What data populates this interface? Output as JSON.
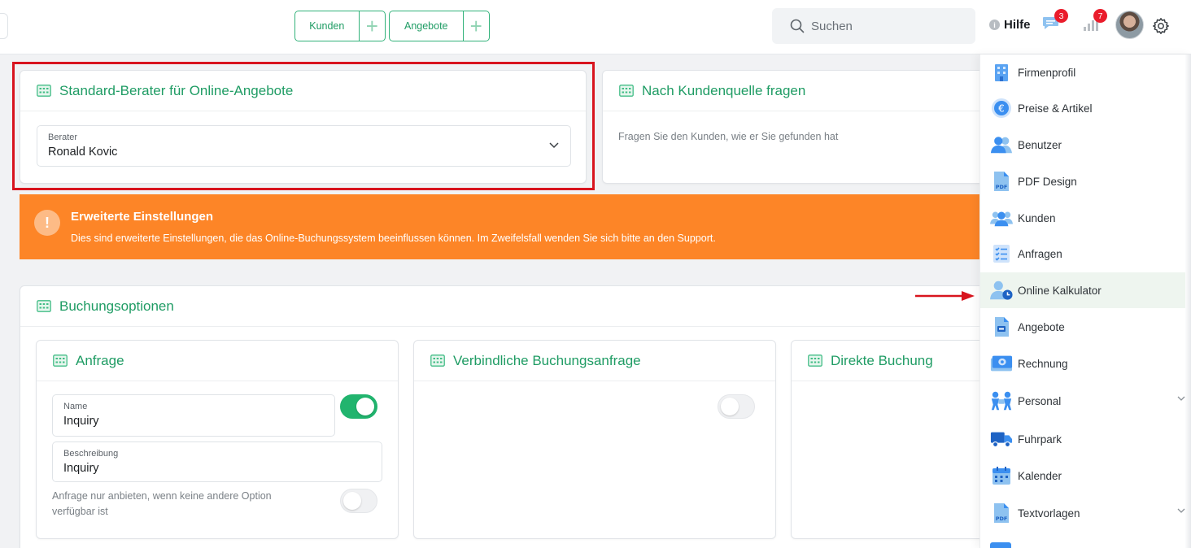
{
  "topbar": {
    "quick_actions": [
      {
        "label": "Kunden",
        "plus": "+"
      },
      {
        "label": "Angebote",
        "plus": "+"
      }
    ],
    "search": {
      "placeholder": "Suchen"
    },
    "help_label": "Hilfe",
    "help_icon_glyph": "i",
    "messages_badge": "3",
    "stats_badge": "7"
  },
  "advisor_card": {
    "title": "Standard-Berater für Online-Angebote",
    "field_label": "Berater",
    "field_value": "Ronald Kovic"
  },
  "source_card": {
    "title": "Nach Kundenquelle fragen",
    "description": "Fragen Sie den Kunden, wie er Sie gefunden hat"
  },
  "warning": {
    "icon_glyph": "!",
    "title": "Erweiterte Einstellungen",
    "description": "Dies sind erweiterte Einstellungen, die das Online-Buchungssystem beeinflussen können. Im Zweifelsfall wenden Sie sich bitte an den Support."
  },
  "booking": {
    "title": "Buchungsoptionen",
    "options": [
      {
        "title": "Anfrage",
        "name_label": "Name",
        "name_value": "Inquiry",
        "desc_label": "Beschreibung",
        "desc_value": "Inquiry",
        "enabled": true,
        "only_if_none_label": "Anfrage nur anbieten, wenn keine andere Option verfügbar ist",
        "only_if_none": false
      },
      {
        "title": "Verbindliche Buchungsanfrage",
        "enabled": false
      },
      {
        "title": "Direkte Buchung"
      }
    ]
  },
  "menu": {
    "items": [
      {
        "label": "Firmenprofil",
        "icon": "building-icon"
      },
      {
        "label": "Preise & Artikel",
        "icon": "euro-icon"
      },
      {
        "label": "Benutzer",
        "icon": "users-icon"
      },
      {
        "label": "PDF Design",
        "icon": "pdf-icon"
      },
      {
        "label": "Kunden",
        "icon": "customers-icon"
      },
      {
        "label": "Anfragen",
        "icon": "checklist-icon"
      },
      {
        "label": "Online Kalkulator",
        "icon": "user-clock-icon",
        "active": true
      },
      {
        "label": "Angebote",
        "icon": "document-icon"
      },
      {
        "label": "Rechnung",
        "icon": "money-icon"
      },
      {
        "label": "Personal",
        "icon": "staff-icon",
        "expandable": true
      },
      {
        "label": "Fuhrpark",
        "icon": "truck-icon"
      },
      {
        "label": "Kalender",
        "icon": "calendar-icon"
      },
      {
        "label": "Textvorlagen",
        "icon": "pdf-icon",
        "expandable": true
      }
    ]
  },
  "colors": {
    "accent": "#1f9c64",
    "toggle_on": "#21b46e",
    "warning": "#fd8527",
    "highlight": "#d8141e",
    "badge": "#ea1c2b",
    "menu_icon": "#3b8ff0"
  }
}
